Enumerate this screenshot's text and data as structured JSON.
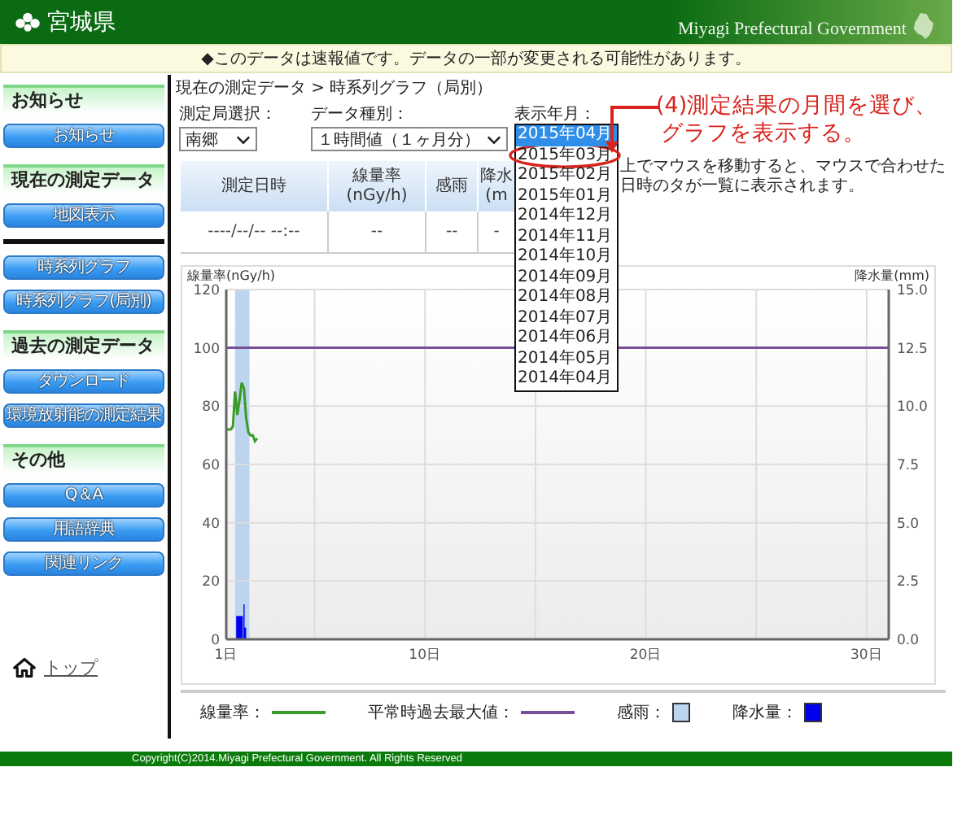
{
  "header": {
    "title": "宮城県",
    "subtitle": "Miyagi Prefectural Government"
  },
  "notice": "◆このデータは速報値です。データの一部が変更される可能性があります。",
  "sidebar": {
    "blocks": [
      {
        "kind": "heading",
        "label": "お知らせ"
      },
      {
        "kind": "button",
        "label": "お知らせ"
      },
      {
        "kind": "heading",
        "label": "現在の測定データ"
      },
      {
        "kind": "button",
        "label": "地図表示"
      },
      {
        "kind": "rule"
      },
      {
        "kind": "button",
        "label": "時系列グラフ"
      },
      {
        "kind": "button",
        "label": "時系列グラフ(局別)"
      },
      {
        "kind": "heading",
        "label": "過去の測定データ"
      },
      {
        "kind": "button",
        "label": "ダウンロード"
      },
      {
        "kind": "button",
        "label": "環境放射能の測定結果"
      },
      {
        "kind": "heading",
        "label": "その他"
      },
      {
        "kind": "button",
        "label": "Q＆A"
      },
      {
        "kind": "button",
        "label": "用語辞典"
      },
      {
        "kind": "button",
        "label": "関連リンク"
      }
    ],
    "home_link": "トップ"
  },
  "main": {
    "breadcrumb": "現在の測定データ > 時系列グラフ（局別）",
    "filters": [
      {
        "kind": "select",
        "label": "測定局選択：",
        "value": "南郷"
      },
      {
        "kind": "select",
        "label": "データ種別：",
        "value": "１時間値（１ヶ月分）"
      },
      {
        "kind": "open-select",
        "label": "表示年月：",
        "options": [
          {
            "label": "2015年04月",
            "selected": true,
            "circled": false
          },
          {
            "label": "2015年03月",
            "selected": false,
            "circled": true
          },
          {
            "label": "2015年02月",
            "selected": false,
            "circled": false
          },
          {
            "label": "2015年01月",
            "selected": false,
            "circled": false
          },
          {
            "label": "2014年12月",
            "selected": false,
            "circled": false
          },
          {
            "label": "2014年11月",
            "selected": false,
            "circled": false
          },
          {
            "label": "2014年10月",
            "selected": false,
            "circled": false
          },
          {
            "label": "2014年09月",
            "selected": false,
            "circled": false
          },
          {
            "label": "2014年08月",
            "selected": false,
            "circled": false
          },
          {
            "label": "2014年07月",
            "selected": false,
            "circled": false
          },
          {
            "label": "2014年06月",
            "selected": false,
            "circled": false
          },
          {
            "label": "2014年05月",
            "selected": false,
            "circled": false
          },
          {
            "label": "2014年04月",
            "selected": false,
            "circled": false
          }
        ]
      }
    ],
    "annotation": [
      "(4)測定結果の月間を選び、",
      "グラフを表示する。"
    ],
    "table": {
      "columns": [
        {
          "lines": [
            "測定日時"
          ]
        },
        {
          "lines": [
            "線量率",
            "(nGy/h)"
          ]
        },
        {
          "lines": [
            "感雨"
          ]
        },
        {
          "lines": [
            "降水",
            "(m"
          ]
        }
      ],
      "rows": [
        [
          "----/--/-- --:--",
          "--",
          "--",
          "-"
        ]
      ]
    },
    "note": "上でマウスを移動すると、マウスで合わせた日時のタが一覧に表示されます。",
    "chart": {
      "chart_data": {
        "type": "line",
        "ylabel": "線量率(nGy/h)",
        "y2label": "降水量(mm)",
        "grid": true,
        "x": [
          1.0,
          1.1,
          1.2,
          1.3,
          1.4,
          1.5,
          1.6,
          1.7,
          1.8,
          1.9,
          2.0,
          2.1,
          2.2,
          2.3,
          2.4,
          31
        ],
        "xlim": [
          1,
          31
        ],
        "ylim": [
          0,
          120
        ],
        "y2lim": [
          0,
          15
        ],
        "xticks": [
          {
            "value": 1,
            "label": "1日"
          },
          {
            "value": 10,
            "label": "10日"
          },
          {
            "value": 20,
            "label": "20日"
          },
          {
            "value": 30,
            "label": "30日"
          }
        ],
        "yticks": [
          0,
          20,
          40,
          60,
          80,
          100,
          120
        ],
        "y2ticks": [
          {
            "value": 0,
            "label": "0.0"
          },
          {
            "value": 2.5,
            "label": "2.5"
          },
          {
            "value": 5,
            "label": "5.0"
          },
          {
            "value": 7.5,
            "label": "7.5"
          },
          {
            "value": 10,
            "label": "10.0"
          },
          {
            "value": 12.5,
            "label": "12.5"
          },
          {
            "value": 15,
            "label": "15.0"
          }
        ],
        "series": [
          {
            "color": "#7a4f9a",
            "values": [
              100,
              100,
              100,
              100,
              100,
              100,
              100,
              100,
              100,
              100,
              100,
              100,
              100,
              100,
              100,
              100
            ]
          },
          {
            "color": "#3a9a2a",
            "values": [
              72,
              72,
              72,
              73,
              85,
              77,
              82,
              88,
              86,
              76,
              71,
              70,
              70,
              68,
              69,
              null
            ]
          }
        ]
      },
      "legend": [
        {
          "label": "線量率：",
          "kind": "line",
          "color": "#3a9a2a"
        },
        {
          "label": "平常時過去最大値：",
          "kind": "line",
          "color": "#7a4f9a"
        },
        {
          "label": "感雨：",
          "kind": "box",
          "color": "#bcd4ee"
        },
        {
          "label": "降水量：",
          "kind": "box",
          "color": "#0000ee"
        }
      ]
    }
  },
  "footer": "Copyright(C)2014.Miyagi Prefectural Government. All Rights Reserved"
}
